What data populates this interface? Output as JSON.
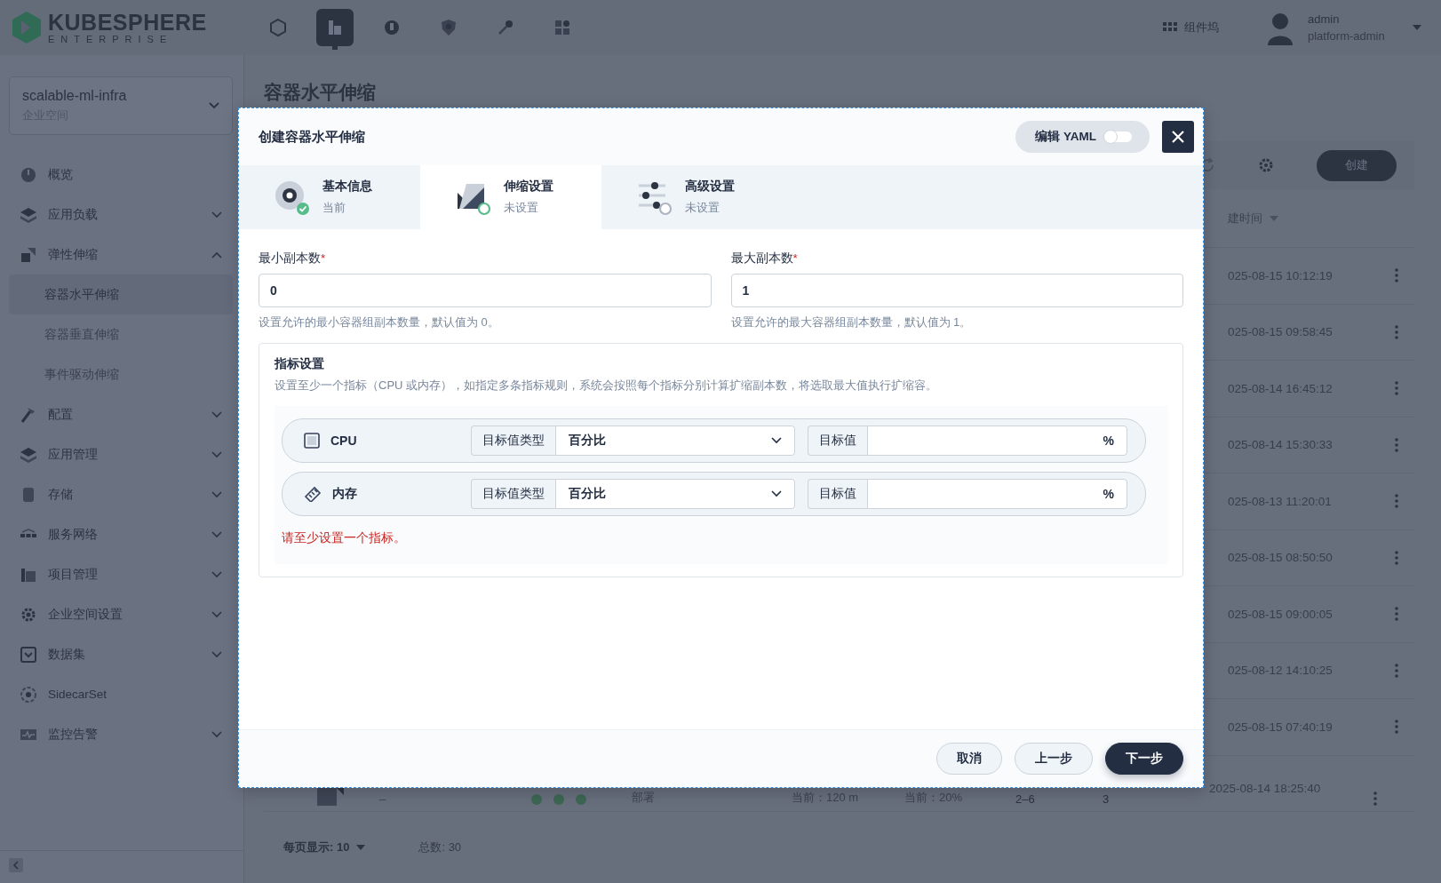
{
  "top_bar": {
    "logo": {
      "name": "KUBESPHERE",
      "edition": "ENTERPRISE"
    },
    "nav_icons": [
      {
        "kind": "cube",
        "selected": false
      },
      {
        "kind": "building",
        "selected": true
      },
      {
        "kind": "plug",
        "selected": false
      },
      {
        "kind": "shield",
        "selected": false
      },
      {
        "kind": "key",
        "selected": false
      },
      {
        "kind": "apps",
        "selected": false
      }
    ],
    "dock": "组件坞",
    "user": {
      "name": "admin",
      "role": "platform-admin"
    }
  },
  "sidebar": {
    "workspace": {
      "name": "scalable-ml-infra",
      "type": "企业空间"
    },
    "items": [
      {
        "label": "概览",
        "kind": "link"
      },
      {
        "label": "应用负载",
        "kind": "group",
        "expanded": false
      },
      {
        "label": "弹性伸缩",
        "kind": "group",
        "expanded": true,
        "children": [
          {
            "label": "容器水平伸缩",
            "selected": true
          },
          {
            "label": "容器垂直伸缩",
            "selected": false
          },
          {
            "label": "事件驱动伸缩",
            "selected": false
          }
        ]
      },
      {
        "label": "配置",
        "kind": "group",
        "expanded": false
      },
      {
        "label": "应用管理",
        "kind": "group",
        "expanded": false
      },
      {
        "label": "存储",
        "kind": "group",
        "expanded": false
      },
      {
        "label": "服务网络",
        "kind": "group",
        "expanded": false
      },
      {
        "label": "项目管理",
        "kind": "group",
        "expanded": false
      },
      {
        "label": "企业空间设置",
        "kind": "group",
        "expanded": false
      },
      {
        "label": "数据集",
        "kind": "group",
        "expanded": false
      },
      {
        "label": "SidecarSet",
        "kind": "link"
      },
      {
        "label": "监控告警",
        "kind": "group",
        "expanded": false
      }
    ]
  },
  "page": {
    "title": "容器水平伸缩",
    "create_button": "创建",
    "column_header": "建时间",
    "rows": [
      {
        "time": "025-08-15 10:12:19"
      },
      {
        "time": "025-08-15 09:58:45"
      },
      {
        "time": "025-08-14 16:45:12"
      },
      {
        "time": "025-08-14 15:30:33"
      },
      {
        "time": "025-08-13 11:20:01"
      },
      {
        "time": "025-08-15 08:50:50"
      },
      {
        "time": "025-08-15 09:00:05"
      },
      {
        "time": "025-08-12 14:10:25"
      },
      {
        "time": "025-08-15 07:40:19"
      }
    ],
    "last_row": {
      "name": "–",
      "type": "部署",
      "cpu": "当前：120 m",
      "memory": "当前：20%",
      "range": "2–6",
      "replicas": "3",
      "time": "2025-08-14 18:25:40"
    },
    "pagination": {
      "page_size": "每页显示: 10",
      "total": "总数: 30"
    }
  },
  "dialog": {
    "title": "创建容器水平伸缩",
    "yaml_toggle": {
      "label": "编辑 YAML",
      "on": false
    },
    "steps": [
      {
        "title": "基本信息",
        "status_text": "当前",
        "completed": true,
        "selected": false
      },
      {
        "title": "伸缩设置",
        "status_text": "未设置",
        "completed": false,
        "selected": true
      },
      {
        "title": "高级设置",
        "status_text": "未设置",
        "completed": false,
        "selected": false
      }
    ],
    "fields": [
      {
        "label": "最小副本数",
        "required_mark": "*",
        "value": "0",
        "hint": "设置允许的最小容器组副本数量，默认值为 0。"
      },
      {
        "label": "最大副本数",
        "required_mark": "*",
        "value": "1",
        "hint": "设置允许的最大容器组副本数量，默认值为 1。"
      }
    ],
    "metrics": {
      "title": "指标设置",
      "description": "设置至少一个指标（CPU 或内存），如指定多条指标规则，系统会按照每个指标分别计算扩缩副本数，将选取最大值执行扩缩容。",
      "rows": [
        {
          "name": "CPU",
          "kind": "cpu",
          "type_label": "目标值类型",
          "type_value": "百分比",
          "target_label": "目标值",
          "unit": "%"
        },
        {
          "name": "内存",
          "kind": "memory",
          "type_label": "目标值类型",
          "type_value": "百分比",
          "target_label": "目标值",
          "unit": "%"
        }
      ],
      "error": "请至少设置一个指标。"
    },
    "buttons": [
      {
        "label": "取消",
        "kind": "secondary"
      },
      {
        "label": "上一步",
        "kind": "secondary"
      },
      {
        "label": "下一步",
        "kind": "primary"
      }
    ]
  }
}
